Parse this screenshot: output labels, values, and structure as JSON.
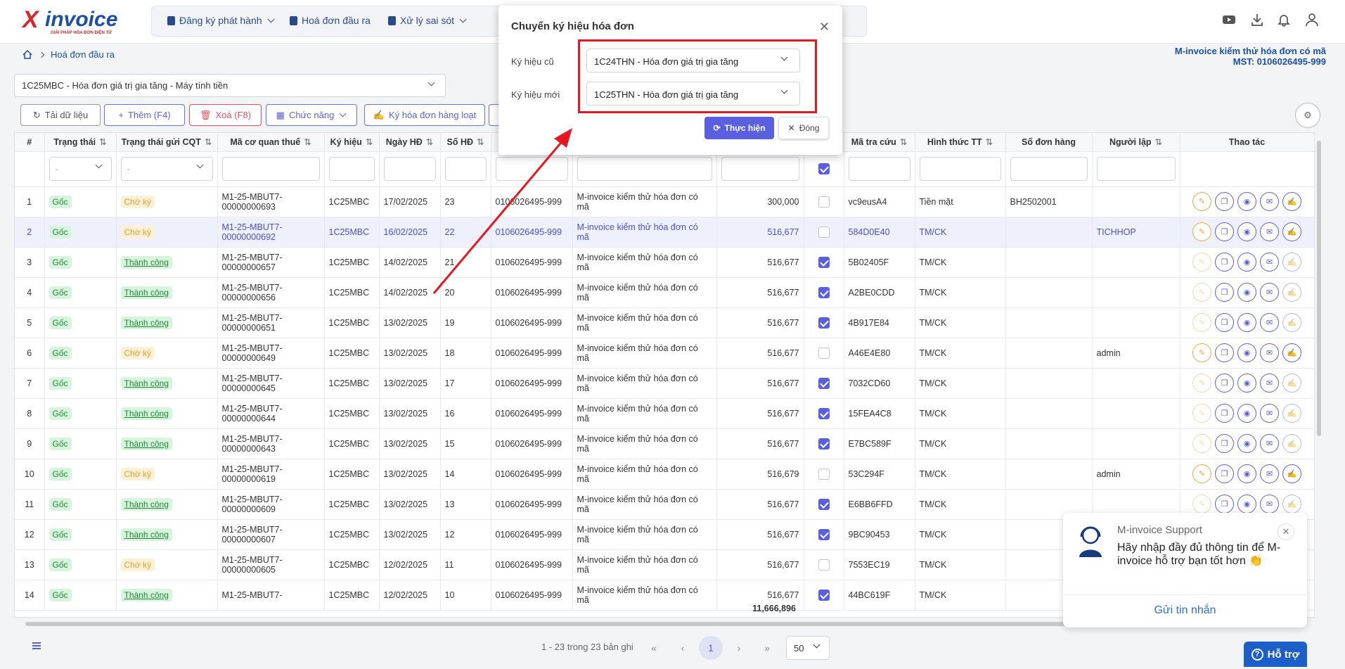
{
  "app": {
    "logo_text": "invoice",
    "logo_slogan": "GIẢI PHÁP HÓA ĐƠN ĐIỆN TỬ"
  },
  "nav": [
    {
      "label": "Đăng ký phát hành",
      "has_dropdown": true
    },
    {
      "label": "Hoá đơn đầu ra",
      "has_dropdown": false
    },
    {
      "label": "Xử lý sai sót",
      "has_dropdown": true
    }
  ],
  "top_icons": [
    "youtube-icon",
    "download-icon",
    "bell-icon",
    "user-icon"
  ],
  "breadcrumb": {
    "home_icon": "home-icon",
    "current": "Hoá đơn đầu ra"
  },
  "company": {
    "name": "M-invoice kiểm thử hóa đơn có mã",
    "tax_id": "MST: 0106026495-999"
  },
  "template_select": "1C25MBC - Hóa đơn giá trị gia tăng - Máy tính tiền",
  "toolbar": {
    "reload": "Tải dữ liệu",
    "add": "Thêm (F4)",
    "delete": "Xoá (F8)",
    "functions": "Chức năng",
    "bulk_sign": "Ký hóa đơn hàng loạt"
  },
  "columns": [
    "#",
    "Trạng thái",
    "Trạng thái gửi CQT",
    "Mã cơ quan thuế",
    "Ký hiệu",
    "Ngày HĐ",
    "Số HĐ",
    "",
    "",
    "",
    "",
    "Mã tra cứu",
    "Hình thức TT",
    "Số đơn hàng",
    "Người lập",
    "Thao tác"
  ],
  "filter_placeholder": "-",
  "rows": [
    {
      "no": "1",
      "status": "Gốc",
      "send": "Chờ ký",
      "send_type": "w",
      "tax_code": "M1-25-MBUT7-00000000693",
      "symbol": "1C25MBC",
      "date": "17/02/2025",
      "inv_no": "23",
      "mst": "0106026495-999",
      "buyer": "M-invoice kiểm thử hóa đơn có mã",
      "amount": "300,000",
      "checked": false,
      "lookup": "vc9eusA4",
      "payment": "Tiền mặt",
      "order": "BH2502001",
      "creator": "",
      "selected": false
    },
    {
      "no": "2",
      "status": "Gốc",
      "send": "Chờ ký",
      "send_type": "w",
      "tax_code": "M1-25-MBUT7-00000000692",
      "symbol": "1C25MBC",
      "date": "16/02/2025",
      "inv_no": "22",
      "mst": "0106026495-999",
      "buyer": "M-invoice kiểm thử hóa đơn có mã",
      "amount": "516,677",
      "checked": false,
      "lookup": "584D0E40",
      "payment": "TM/CK",
      "order": "",
      "creator": "TICHHOP",
      "selected": true
    },
    {
      "no": "3",
      "status": "Gốc",
      "send": "Thành công",
      "send_type": "s",
      "tax_code": "M1-25-MBUT7-00000000657",
      "symbol": "1C25MBC",
      "date": "14/02/2025",
      "inv_no": "21",
      "mst": "0106026495-999",
      "buyer": "M-invoice kiểm thử hóa đơn có mã",
      "amount": "516,677",
      "checked": true,
      "lookup": "5B02405F",
      "payment": "TM/CK",
      "order": "",
      "creator": "",
      "selected": false
    },
    {
      "no": "4",
      "status": "Gốc",
      "send": "Thành công",
      "send_type": "s",
      "tax_code": "M1-25-MBUT7-00000000656",
      "symbol": "1C25MBC",
      "date": "14/02/2025",
      "inv_no": "20",
      "mst": "0106026495-999",
      "buyer": "M-invoice kiểm thử hóa đơn có mã",
      "amount": "516,677",
      "checked": true,
      "lookup": "A2BE0CDD",
      "payment": "TM/CK",
      "order": "",
      "creator": "",
      "selected": false
    },
    {
      "no": "5",
      "status": "Gốc",
      "send": "Thành công",
      "send_type": "s",
      "tax_code": "M1-25-MBUT7-00000000651",
      "symbol": "1C25MBC",
      "date": "13/02/2025",
      "inv_no": "19",
      "mst": "0106026495-999",
      "buyer": "M-invoice kiểm thử hóa đơn có mã",
      "amount": "516,677",
      "checked": true,
      "lookup": "4B917E84",
      "payment": "TM/CK",
      "order": "",
      "creator": "",
      "selected": false
    },
    {
      "no": "6",
      "status": "Gốc",
      "send": "Chờ ký",
      "send_type": "w",
      "tax_code": "M1-25-MBUT7-00000000649",
      "symbol": "1C25MBC",
      "date": "13/02/2025",
      "inv_no": "18",
      "mst": "0106026495-999",
      "buyer": "M-invoice kiểm thử hóa đơn có mã",
      "amount": "516,677",
      "checked": false,
      "lookup": "A46E4E80",
      "payment": "TM/CK",
      "order": "",
      "creator": "admin",
      "selected": false
    },
    {
      "no": "7",
      "status": "Gốc",
      "send": "Thành công",
      "send_type": "s",
      "tax_code": "M1-25-MBUT7-00000000645",
      "symbol": "1C25MBC",
      "date": "13/02/2025",
      "inv_no": "17",
      "mst": "0106026495-999",
      "buyer": "M-invoice kiểm thử hóa đơn có mã",
      "amount": "516,677",
      "checked": true,
      "lookup": "7032CD60",
      "payment": "TM/CK",
      "order": "",
      "creator": "",
      "selected": false
    },
    {
      "no": "8",
      "status": "Gốc",
      "send": "Thành công",
      "send_type": "s",
      "tax_code": "M1-25-MBUT7-00000000644",
      "symbol": "1C25MBC",
      "date": "13/02/2025",
      "inv_no": "16",
      "mst": "0106026495-999",
      "buyer": "M-invoice kiểm thử hóa đơn có mã",
      "amount": "516,677",
      "checked": true,
      "lookup": "15FEA4C8",
      "payment": "TM/CK",
      "order": "",
      "creator": "",
      "selected": false
    },
    {
      "no": "9",
      "status": "Gốc",
      "send": "Thành công",
      "send_type": "s",
      "tax_code": "M1-25-MBUT7-00000000643",
      "symbol": "1C25MBC",
      "date": "13/02/2025",
      "inv_no": "15",
      "mst": "0106026495-999",
      "buyer": "M-invoice kiểm thử hóa đơn có mã",
      "amount": "516,677",
      "checked": true,
      "lookup": "E7BC589F",
      "payment": "TM/CK",
      "order": "",
      "creator": "",
      "selected": false
    },
    {
      "no": "10",
      "status": "Gốc",
      "send": "Chờ ký",
      "send_type": "w",
      "tax_code": "M1-25-MBUT7-00000000619",
      "symbol": "1C25MBC",
      "date": "13/02/2025",
      "inv_no": "14",
      "mst": "0106026495-999",
      "buyer": "M-invoice kiểm thử hóa đơn có mã",
      "amount": "516,679",
      "checked": false,
      "lookup": "53C294F",
      "payment": "TM/CK",
      "order": "",
      "creator": "admin",
      "selected": false
    },
    {
      "no": "11",
      "status": "Gốc",
      "send": "Thành công",
      "send_type": "s",
      "tax_code": "M1-25-MBUT7-00000000609",
      "symbol": "1C25MBC",
      "date": "13/02/2025",
      "inv_no": "13",
      "mst": "0106026495-999",
      "buyer": "M-invoice kiểm thử hóa đơn có mã",
      "amount": "516,677",
      "checked": true,
      "lookup": "E6BB6FFD",
      "payment": "TM/CK",
      "order": "",
      "creator": "",
      "selected": false
    },
    {
      "no": "12",
      "status": "Gốc",
      "send": "Thành công",
      "send_type": "s",
      "tax_code": "M1-25-MBUT7-00000000607",
      "symbol": "1C25MBC",
      "date": "13/02/2025",
      "inv_no": "12",
      "mst": "0106026495-999",
      "buyer": "M-invoice kiểm thử hóa đơn có mã",
      "amount": "516,677",
      "checked": true,
      "lookup": "9BC90453",
      "payment": "TM/CK",
      "order": "",
      "creator": "",
      "selected": false
    },
    {
      "no": "13",
      "status": "Gốc",
      "send": "Chờ ký",
      "send_type": "w",
      "tax_code": "M1-25-MBUT7-00000000605",
      "symbol": "1C25MBC",
      "date": "12/02/2025",
      "inv_no": "11",
      "mst": "0106026495-999",
      "buyer": "M-invoice kiểm thử hóa đơn có mã",
      "amount": "516,677",
      "checked": false,
      "lookup": "7553EC19",
      "payment": "TM/CK",
      "order": "",
      "creator": "",
      "selected": false
    },
    {
      "no": "14",
      "status": "Gốc",
      "send": "Thành công",
      "send_type": "s",
      "tax_code": "M1-25-MBUT7-",
      "symbol": "1C25MBC",
      "date": "12/02/2025",
      "inv_no": "10",
      "mst": "0106026495-999",
      "buyer": "M-invoice kiểm thử hóa đơn có mã",
      "amount": "516,677",
      "checked": true,
      "lookup": "44BC619F",
      "payment": "TM/CK",
      "order": "",
      "creator": "",
      "selected": false
    }
  ],
  "total_amount": "11,666,896",
  "pagination": {
    "info": "1 - 23 trong 23 bản ghi",
    "current": "1",
    "page_size": "50"
  },
  "modal": {
    "title": "Chuyển ký hiệu hóa đơn",
    "old_label": "Ký hiệu cũ",
    "old_value": "1C24THN - Hóa đơn giá trị gia tăng",
    "new_label": "Ký hiệu mới",
    "new_value": "1C25THN - Hóa đơn giá trị gia tăng",
    "execute": "Thực hiện",
    "close": "Đóng"
  },
  "chat": {
    "name": "M-invoice Support",
    "message": "Hãy nhập đầy đủ thông tin để M-invoice hỗ trợ bạn tốt hơn 👏",
    "send": "Gửi tin nhắn"
  },
  "help": {
    "label": "Hỗ trợ"
  },
  "colors": {
    "accent": "#5a5fe0",
    "brand_blue": "#1b4fa8",
    "brand_red": "#d9262c",
    "highlight": "#e5171f",
    "success": "#23853a",
    "warning": "#d9a13a"
  }
}
